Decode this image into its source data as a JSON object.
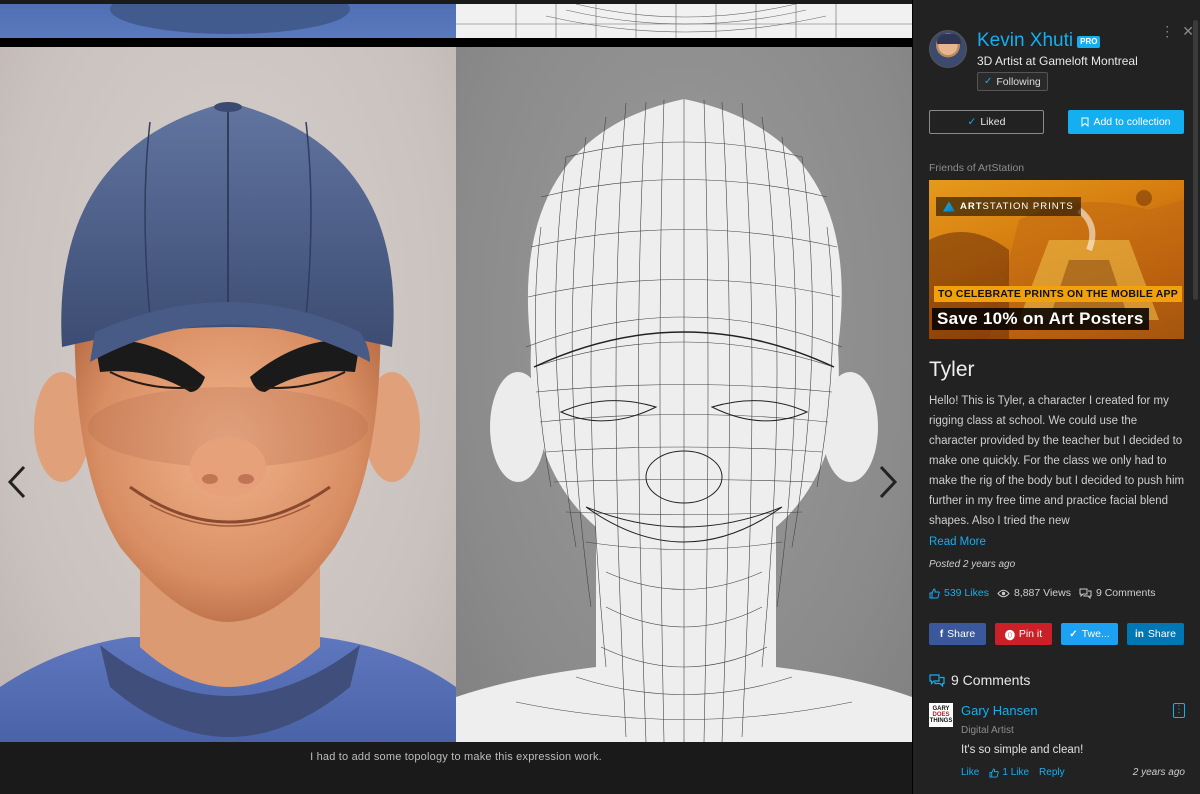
{
  "viewer": {
    "caption": "I had to add some topology to make this expression work.",
    "prev_icon": "chevron-left-icon",
    "next_icon": "chevron-right-icon"
  },
  "artist": {
    "name": "Kevin Xhuti",
    "badge": "PRO",
    "headline": "3D Artist at Gameloft Montreal",
    "follow_label": "Following"
  },
  "actions": {
    "liked_label": "Liked",
    "collection_label": "Add to collection"
  },
  "ad": {
    "section_label": "Friends of ArtStation",
    "brand_bold": "ART",
    "brand_rest": "STATION PRINTS",
    "subtitle": "TO CELEBRATE PRINTS ON THE MOBILE APP",
    "headline": "Save 10% on Art Posters"
  },
  "project": {
    "title": "Tyler",
    "description": "Hello! This is Tyler, a character I created for my rigging class at school. We could use the character provided by the teacher but I decided to make one quickly. For the class we only had to make the rig of the body but I decided to push him further in my free time and practice facial blend shapes. Also I tried the new",
    "read_more": "Read More",
    "posted": "Posted 2 years ago"
  },
  "stats": {
    "likes": "539 Likes",
    "views": "8,887 Views",
    "comments": "9 Comments"
  },
  "share": {
    "facebook": "Share",
    "pinterest": "Pin it",
    "twitter": "Twe...",
    "linkedin": "Share"
  },
  "comments_section": {
    "heading": "9 Comments",
    "first": {
      "avatar_line1": "GARY",
      "avatar_line2": "DOES",
      "avatar_line3": "THINGS",
      "author": "Gary Hansen",
      "role": "Digital Artist",
      "text": "It's so simple and clean!",
      "like": "Like",
      "like_count": "1 Like",
      "reply": "Reply",
      "time": "2 years ago"
    }
  },
  "colors": {
    "accent": "#13aff0",
    "sidebar_bg": "#222222",
    "facebook": "#3a589b",
    "pinterest": "#cb2027",
    "twitter": "#1da1f2",
    "linkedin": "#0077b5"
  }
}
